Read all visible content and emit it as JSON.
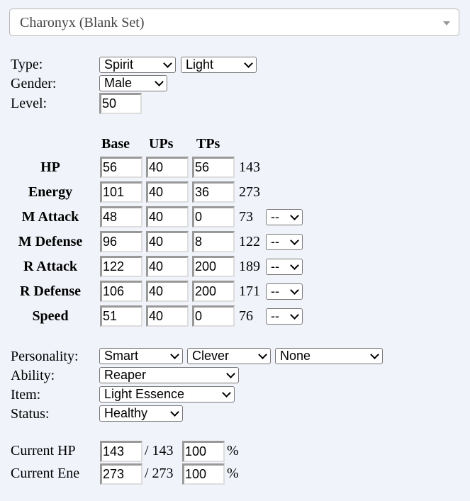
{
  "set_select": "Charonyx (Blank Set)",
  "labels": {
    "type": "Type:",
    "gender": "Gender:",
    "level": "Level:",
    "personality": "Personality:",
    "ability": "Ability:",
    "item": "Item:",
    "status": "Status:",
    "current_hp": "Current HP",
    "current_ene": "Current Ene",
    "percent": "%"
  },
  "type1": "Spirit",
  "type2": "Light",
  "gender": "Male",
  "level": "50",
  "headers": {
    "base": "Base",
    "ups": "UPs",
    "tps": "TPs"
  },
  "stats": [
    {
      "name": "HP",
      "base": "56",
      "ups": "40",
      "tps": "56",
      "total": "143"
    },
    {
      "name": "Energy",
      "base": "101",
      "ups": "40",
      "tps": "36",
      "total": "273"
    },
    {
      "name": "M Attack",
      "base": "48",
      "ups": "40",
      "tps": "0",
      "total": "73",
      "mod": "--"
    },
    {
      "name": "M Defense",
      "base": "96",
      "ups": "40",
      "tps": "8",
      "total": "122",
      "mod": "--"
    },
    {
      "name": "R Attack",
      "base": "122",
      "ups": "40",
      "tps": "200",
      "total": "189",
      "mod": "--"
    },
    {
      "name": "R Defense",
      "base": "106",
      "ups": "40",
      "tps": "200",
      "total": "171",
      "mod": "--"
    },
    {
      "name": "Speed",
      "base": "51",
      "ups": "40",
      "tps": "0",
      "total": "76",
      "mod": "--"
    }
  ],
  "personality": [
    "Smart",
    "Clever",
    "None"
  ],
  "ability": "Reaper",
  "item": "Light Essence",
  "status": "Healthy",
  "current_hp": {
    "value": "143",
    "max": "/ 143",
    "percent": "100"
  },
  "current_ene": {
    "value": "273",
    "max": "/ 273",
    "percent": "100"
  }
}
